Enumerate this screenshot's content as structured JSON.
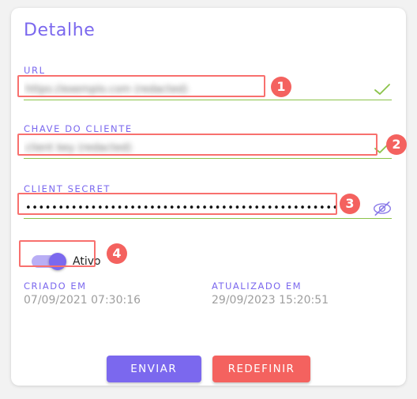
{
  "page": {
    "background_color": "#f2f2f2",
    "card_background": "#ffffff"
  },
  "card": {
    "title": "Detalhe"
  },
  "colors": {
    "accent_purple": "#7b68ee",
    "annotation_red": "#f4625f",
    "valid_green": "#8bc34a",
    "muted_gray": "#9e9e9e"
  },
  "fields": [
    {
      "label": "URL",
      "value": "https://exemplo.com (redacted)",
      "redacted": true,
      "valid_icon": "check-icon",
      "annotation": "1"
    },
    {
      "label": "CHAVE DO CLIENTE",
      "value": "client key (redacted)",
      "redacted": true,
      "valid_icon": "check-icon",
      "annotation": "2"
    },
    {
      "label": "CLIENT SECRET",
      "value": "••••••••••••••••••••••••••••••••••••••••••••••••••",
      "redacted": false,
      "valid_icon": "eye-off-icon",
      "annotation": "3"
    }
  ],
  "toggle": {
    "label": "Ativo",
    "checked": true,
    "annotation": "4"
  },
  "meta": {
    "created": {
      "label": "CRIADO EM",
      "value": "07/09/2021 07:30:16"
    },
    "updated": {
      "label": "ATUALIZADO EM",
      "value": "29/09/2023 15:20:51"
    }
  },
  "buttons": {
    "submit_label": "ENVIAR",
    "reset_label": "REDEFINIR"
  }
}
